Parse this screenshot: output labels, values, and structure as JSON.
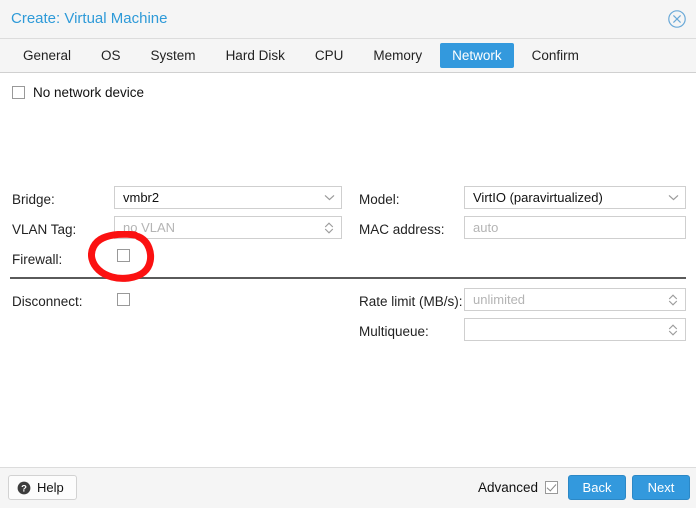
{
  "window": {
    "title": "Create: Virtual Machine",
    "close_icon": "close-circle-icon"
  },
  "tabs": [
    {
      "label": "General",
      "active": false
    },
    {
      "label": "OS",
      "active": false
    },
    {
      "label": "System",
      "active": false
    },
    {
      "label": "Hard Disk",
      "active": false
    },
    {
      "label": "CPU",
      "active": false
    },
    {
      "label": "Memory",
      "active": false
    },
    {
      "label": "Network",
      "active": true
    },
    {
      "label": "Confirm",
      "active": false
    }
  ],
  "form": {
    "no_network_device": {
      "label": "No network device",
      "checked": false
    },
    "bridge": {
      "label": "Bridge:",
      "value": "vmbr2",
      "is_placeholder": false,
      "trigger": "chevron-down-icon"
    },
    "vlan_tag": {
      "label": "VLAN Tag:",
      "value": "no VLAN",
      "is_placeholder": true,
      "trigger": "spinner-icon"
    },
    "firewall": {
      "label": "Firewall:",
      "checked": false
    },
    "model": {
      "label": "Model:",
      "value": "VirtIO (paravirtualized)",
      "is_placeholder": false,
      "trigger": "chevron-down-icon"
    },
    "mac_address": {
      "label": "MAC address:",
      "value": "auto",
      "is_placeholder": true
    },
    "disconnect": {
      "label": "Disconnect:",
      "checked": false
    },
    "rate_limit": {
      "label": "Rate limit (MB/s):",
      "value": "unlimited",
      "is_placeholder": true,
      "trigger": "spinner-icon"
    },
    "multiqueue": {
      "label": "Multiqueue:",
      "value": "",
      "is_placeholder": false,
      "trigger": "spinner-icon"
    }
  },
  "annotation": {
    "shape": "hand-drawn-ellipse",
    "color": "#fb1111",
    "targets": "firewall-checkbox"
  },
  "footer": {
    "help_label": "Help",
    "help_icon": "question-mark-icon",
    "advanced_label": "Advanced",
    "advanced_checked": true,
    "back_label": "Back",
    "next_label": "Next"
  },
  "colors": {
    "accent_blue": "#3399dd",
    "title_blue": "#2e9ad8",
    "annotation_red": "#fb1111"
  }
}
